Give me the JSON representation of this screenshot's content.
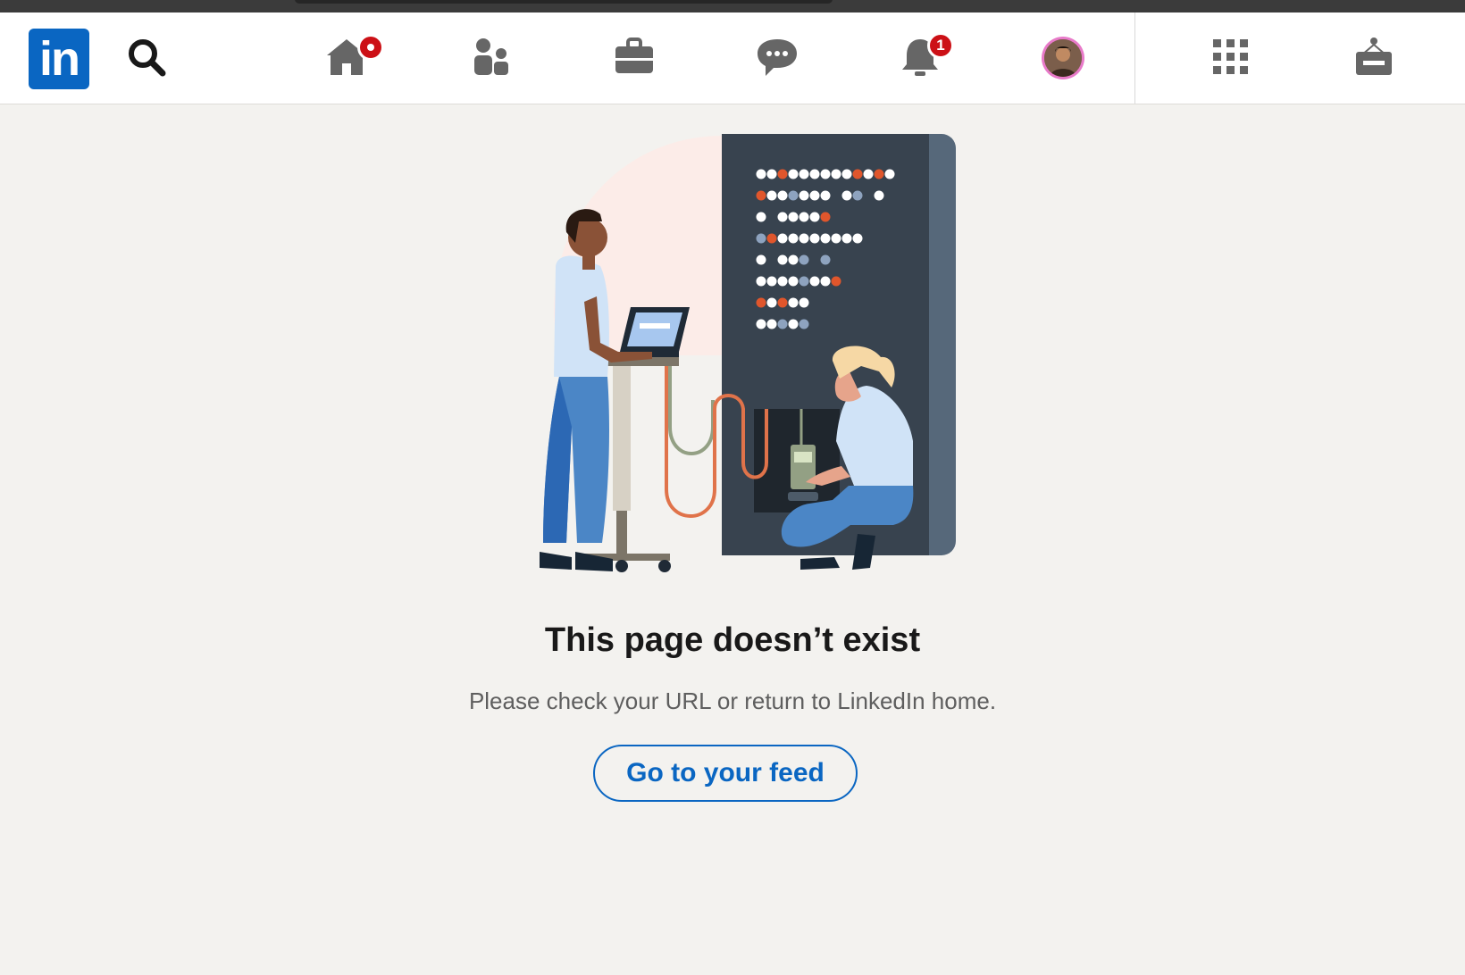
{
  "app": {
    "logo_text": "in",
    "brand_color": "#0a66c2"
  },
  "nav": {
    "icons": [
      "search-icon",
      "home-icon",
      "my-network-icon",
      "jobs-icon",
      "messaging-icon",
      "notifications-icon",
      "me-avatar",
      "work-grid-icon",
      "advertise-icon"
    ],
    "home_badge": "",
    "notifications_badge": "1",
    "badge_color": "#cc1016"
  },
  "error": {
    "title": "This page doesn’t exist",
    "message": "Please check your URL or return to LinkedIn home.",
    "button_label": "Go to your feed"
  }
}
